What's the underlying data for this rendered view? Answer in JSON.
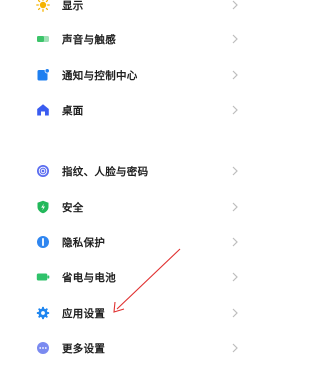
{
  "settings": {
    "items": [
      {
        "label": "显示",
        "icon": "sun-icon",
        "color": "#f5b400"
      },
      {
        "label": "声音与触感",
        "icon": "speaker-icon",
        "color": "#3cc46a"
      },
      {
        "label": "通知与控制中心",
        "icon": "notification-icon",
        "color": "#1e7ff0"
      },
      {
        "label": "桌面",
        "icon": "home-icon",
        "color": "#3a5cf0"
      },
      {
        "label": "指纹、人脸与密码",
        "icon": "fingerprint-icon",
        "color": "#5a6cf0"
      },
      {
        "label": "安全",
        "icon": "shield-icon",
        "color": "#22b85a"
      },
      {
        "label": "隐私保护",
        "icon": "privacy-icon",
        "color": "#2f86f0"
      },
      {
        "label": "省电与电池",
        "icon": "battery-icon",
        "color": "#2fc26a"
      },
      {
        "label": "应用设置",
        "icon": "gear-icon",
        "color": "#1f86f0"
      },
      {
        "label": "更多设置",
        "icon": "more-icon",
        "color": "#7a8af0"
      }
    ]
  },
  "annotation": {
    "icon": "red-arrow-annotation",
    "color": "#e03030"
  }
}
